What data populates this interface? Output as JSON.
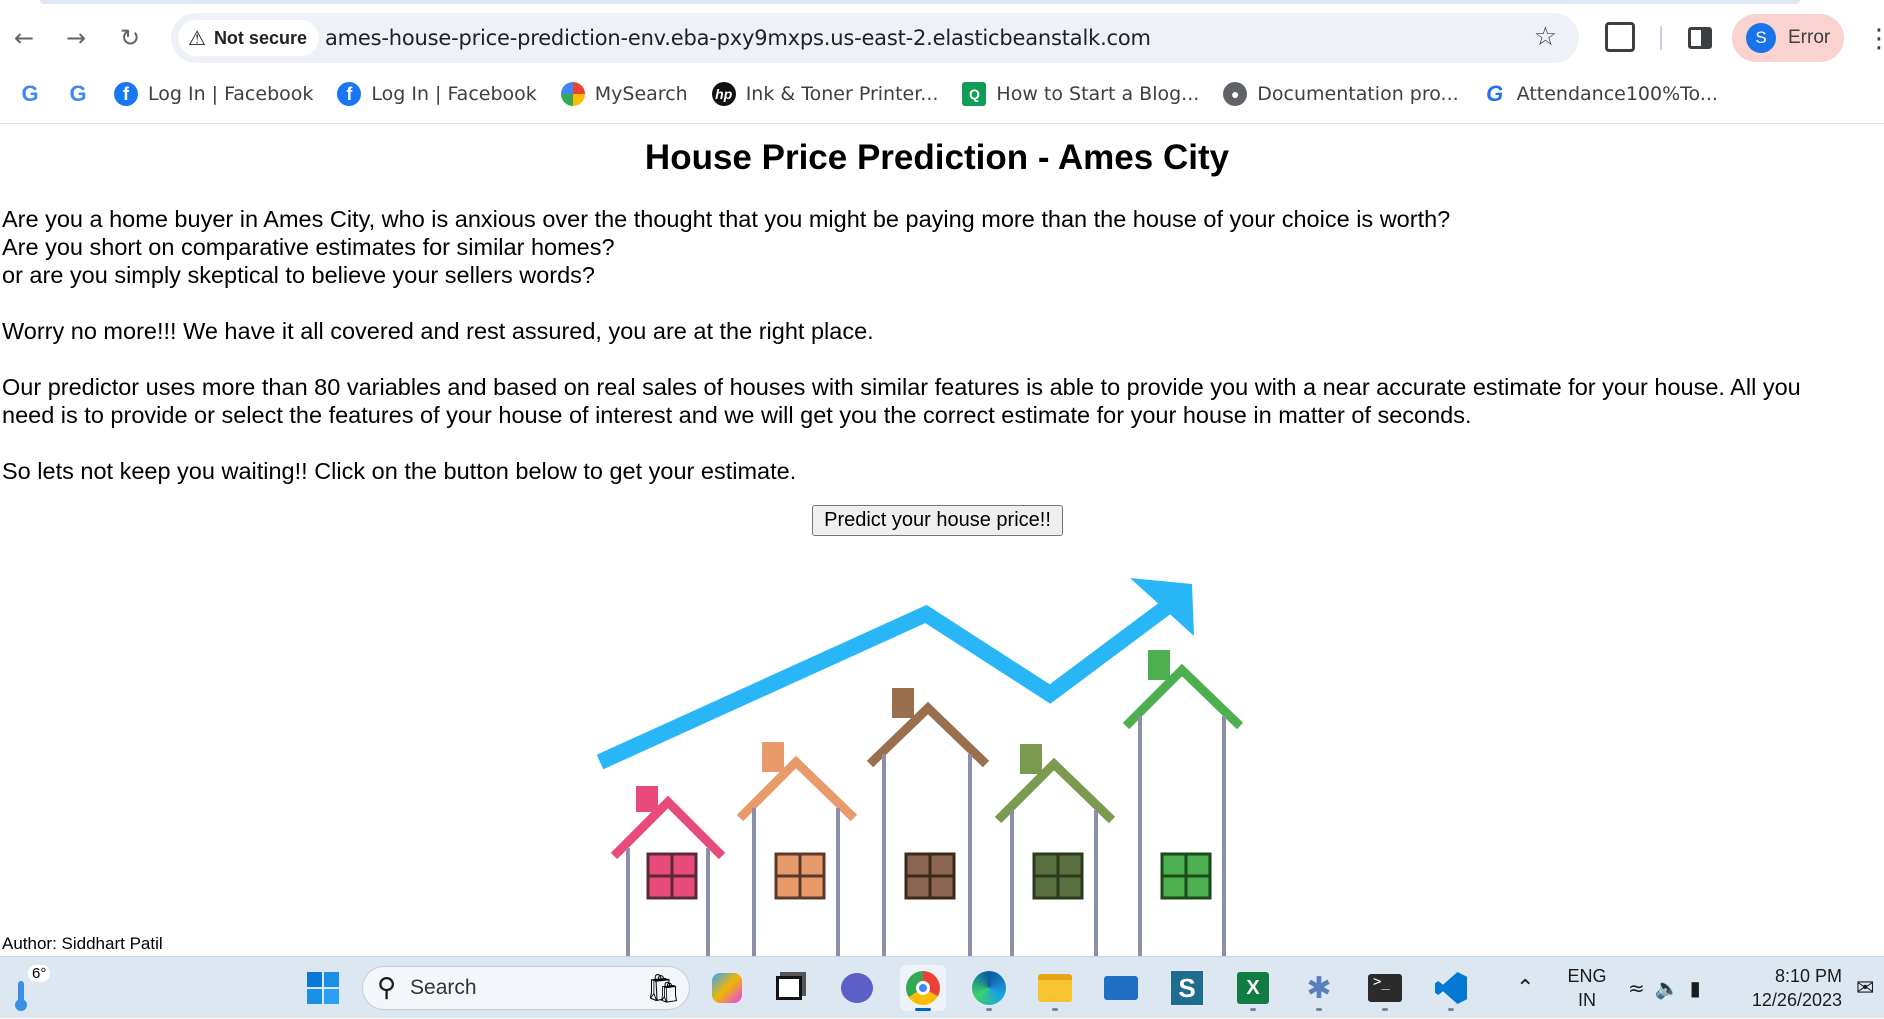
{
  "browser": {
    "security_label": "Not secure",
    "url": "ames-house-price-prediction-env.eba-pxy9mxps.us-east-2.elasticbeanstalk.com",
    "profile_initial": "S",
    "profile_label": "Error",
    "bookmarks": [
      {
        "label": "",
        "icon": "google-icon"
      },
      {
        "label": "",
        "icon": "google-icon"
      },
      {
        "label": "Log In | Facebook",
        "icon": "facebook-icon"
      },
      {
        "label": "Log In | Facebook",
        "icon": "facebook-icon"
      },
      {
        "label": "MySearch",
        "icon": "mysearch-icon"
      },
      {
        "label": "Ink & Toner Printer...",
        "icon": "hp-icon"
      },
      {
        "label": "How to Start a Blog...",
        "icon": "blog-icon"
      },
      {
        "label": "Documentation pro...",
        "icon": "globe-icon"
      },
      {
        "label": "Attendance100%To...",
        "icon": "google-icon"
      }
    ]
  },
  "page": {
    "title": "House Price Prediction - Ames City",
    "intro_lines": [
      "Are you a home buyer in Ames City, who is anxious over the thought that you might be paying more than the house of your choice is worth?",
      "Are you short on comparative estimates for similar homes?",
      "or are you simply skeptical to believe your sellers words?"
    ],
    "reassure": "Worry no more!!! We have it all covered and rest assured, you are at the right place.",
    "predictor_line1": "Our predictor uses more than 80 variables and based on real sales of houses with similar features is able to provide you with a near accurate estimate for your house. All you",
    "predictor_line2": "need is to provide or select the features of your house of interest and we will get you the correct estimate for your house in matter of seconds.",
    "cta_text": "So lets not keep you waiting!! Click on the button below to get your estimate.",
    "button_label": "Predict your house price!!",
    "author": "Author: Siddhart Patil"
  },
  "taskbar": {
    "weather_temp": "6°",
    "search_label": "Search",
    "lang_line1": "ENG",
    "lang_line2": "IN",
    "time": "8:10 PM",
    "date": "12/26/2023"
  },
  "colors": {
    "accent": "#1a73e8",
    "profile_chip": "#fad2cf",
    "arrow": "#29b6f6"
  }
}
